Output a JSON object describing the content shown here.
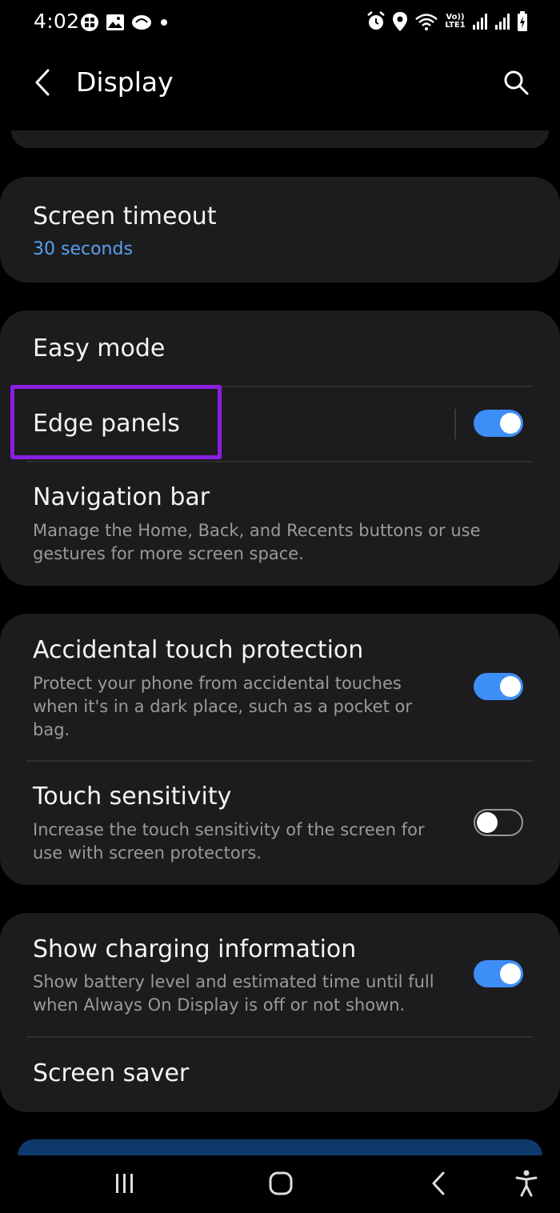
{
  "status_bar": {
    "time": "4:02",
    "left_icons": [
      "shortcut-icon",
      "gallery-icon",
      "app-icon",
      "notification-dot-icon"
    ],
    "right_icons": [
      "alarm-icon",
      "location-icon",
      "wifi-icon",
      "volte-icon",
      "signal-icon",
      "signal-icon",
      "battery-charging-icon"
    ],
    "volte_label": "Vo)) LTE1"
  },
  "header": {
    "title": "Display",
    "back_icon": "chevron-left-icon",
    "search_icon": "search-icon"
  },
  "sections": {
    "screen_timeout": {
      "title": "Screen timeout",
      "value": "30 seconds"
    },
    "easy_mode": {
      "title": "Easy mode"
    },
    "edge_panels": {
      "title": "Edge panels",
      "enabled": true
    },
    "navigation_bar": {
      "title": "Navigation bar",
      "description_line1": "Manage the Home, Back, and Recents buttons or use",
      "description_line2": "gestures for more screen space."
    },
    "accidental_touch": {
      "title": "Accidental touch protection",
      "description_line1": "Protect your phone from accidental touches",
      "description_line2": "when it's in a dark place, such as a pocket or",
      "description_line3": "bag.",
      "enabled": true
    },
    "touch_sensitivity": {
      "title": "Touch sensitivity",
      "description_line1": "Increase the touch sensitivity of the screen for",
      "description_line2": "use with screen protectors.",
      "enabled": false
    },
    "charging_info": {
      "title": "Show charging information",
      "description_line1": "Show battery level and estimated time until full",
      "description_line2": "when Always On Display is off or not shown.",
      "enabled": true
    },
    "screen_saver": {
      "title": "Screen saver"
    }
  },
  "nav_bar": {
    "buttons": [
      "recents-icon",
      "home-icon",
      "back-icon",
      "accessibility-icon"
    ]
  },
  "colors": {
    "accent": "#3e8ef7",
    "link_blue": "#5aa1f0",
    "highlight": "#8a1fe0",
    "card_bg": "#1c1c1e",
    "background": "#000000"
  }
}
